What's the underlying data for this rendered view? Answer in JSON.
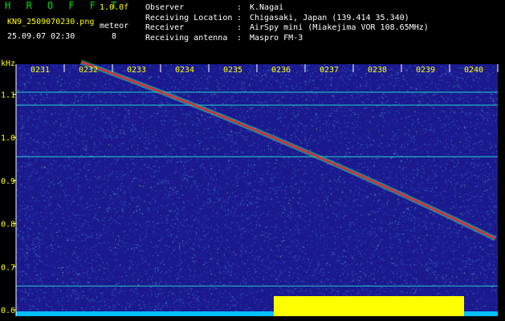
{
  "header": {
    "app_title": "H R O F F T",
    "version": "1.0.0f",
    "filename": "KN9_2509070230.png",
    "meteor_label": "meteor",
    "timestamp": "25.09.07 02:30",
    "meteor_count": "8"
  },
  "info": [
    {
      "label": "Observer",
      "sep": ":",
      "value": "K.Nagai"
    },
    {
      "label": "Receiving Location",
      "sep": ":",
      "value": "Chigasaki, Japan (139.414 35.340)"
    },
    {
      "label": "Receiver",
      "sep": ":",
      "value": "AirSpy mini (Miakejima VOR 108.65MHz)"
    },
    {
      "label": "Receiving antenna",
      "sep": ":",
      "value": "Maspro FM-3"
    }
  ],
  "spectrogram": {
    "y_unit": "kHz",
    "y_ticks": [
      "1.1",
      "1.0",
      "0.9",
      "0.8",
      "0.7",
      "0.6"
    ],
    "y_range_khz": [
      0.585,
      1.17
    ],
    "time_ticks": [
      "0231",
      "0232",
      "0233",
      "0234",
      "0235",
      "0236",
      "0237",
      "0238",
      "0239",
      "0240"
    ],
    "time_range_min": [
      0,
      10
    ],
    "colors": {
      "background": "#1a1a8e",
      "trail": "#ff2020",
      "signal_bar": "#ffff00",
      "baseline_bar": "#00bfff",
      "axis_text": "#ffff00",
      "constant_line": "#20c8c8"
    },
    "meteor_trail": {
      "start": {
        "t_min": 1.35,
        "khz": 1.175
      },
      "end": {
        "t_min": 9.95,
        "khz": 0.765
      }
    },
    "constant_lines_khz": [
      1.105,
      1.075,
      0.955,
      0.655
    ],
    "signal_block_minutes": [
      5.35,
      9.3
    ]
  }
}
